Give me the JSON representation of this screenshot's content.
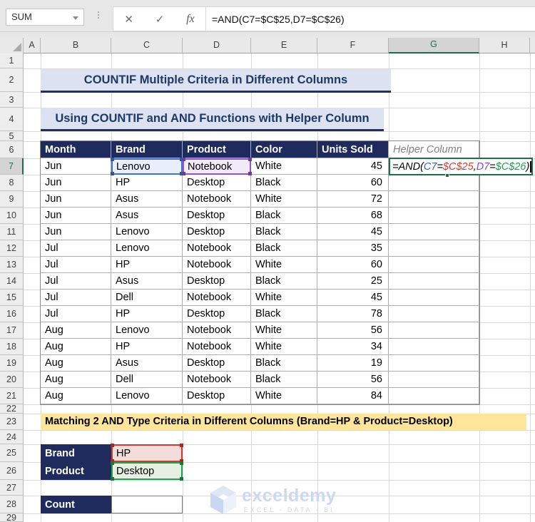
{
  "formula_bar": {
    "name_box": "SUM",
    "cancel_icon": "✕",
    "enter_icon": "✓",
    "fx_icon": "fx",
    "formula": "=AND(C7=$C$25,D7=$C$26)"
  },
  "grid": {
    "column_letters": [
      "A",
      "B",
      "C",
      "D",
      "E",
      "F",
      "G",
      "H"
    ],
    "active_column": "G",
    "active_row": 7,
    "row_count": 29
  },
  "titles": {
    "main": "COUNTIF Multiple Criteria in Different Columns",
    "sub": "Using COUNTIF and AND Functions with Helper Column"
  },
  "table": {
    "headers": [
      "Month",
      "Brand",
      "Product",
      "Color",
      "Units Sold",
      "Helper Column"
    ],
    "rows": [
      [
        "Jun",
        "Lenovo",
        "Notebook",
        "White",
        "45",
        ""
      ],
      [
        "Jun",
        "HP",
        "Desktop",
        "Black",
        "60",
        ""
      ],
      [
        "Jun",
        "Asus",
        "Notebook",
        "White",
        "72",
        ""
      ],
      [
        "Jun",
        "Asus",
        "Desktop",
        "Black",
        "68",
        ""
      ],
      [
        "Jun",
        "Lenovo",
        "Desktop",
        "Black",
        "45",
        ""
      ],
      [
        "Jul",
        "Lenovo",
        "Notebook",
        "Black",
        "35",
        ""
      ],
      [
        "Jul",
        "HP",
        "Notebook",
        "White",
        "60",
        ""
      ],
      [
        "Jul",
        "Asus",
        "Desktop",
        "Black",
        "25",
        ""
      ],
      [
        "Jul",
        "Dell",
        "Notebook",
        "White",
        "45",
        ""
      ],
      [
        "Jul",
        "HP",
        "Desktop",
        "Black",
        "78",
        ""
      ],
      [
        "Aug",
        "Lenovo",
        "Notebook",
        "White",
        "56",
        ""
      ],
      [
        "Aug",
        "HP",
        "Notebook",
        "White",
        "34",
        ""
      ],
      [
        "Aug",
        "Asus",
        "Desktop",
        "Black",
        "19",
        ""
      ],
      [
        "Aug",
        "Dell",
        "Notebook",
        "Black",
        "56",
        ""
      ],
      [
        "Aug",
        "Lenovo",
        "Desktop",
        "White",
        "84",
        ""
      ]
    ]
  },
  "cell_formula_tokens": [
    {
      "text": "=AND(",
      "color": "#000000"
    },
    {
      "text": "C7",
      "color": "#3a60c8"
    },
    {
      "text": "=",
      "color": "#000000"
    },
    {
      "text": "$C$25",
      "color": "#d43e36"
    },
    {
      "text": ",",
      "color": "#000000"
    },
    {
      "text": "D7",
      "color": "#8a4bc9"
    },
    {
      "text": "=",
      "color": "#000000"
    },
    {
      "text": "$C$26",
      "color": "#1d9e50"
    },
    {
      "text": ")",
      "color": "#000000"
    }
  ],
  "banner": "Matching 2 AND Type Criteria in Different Columns (Brand=HP & Product=Desktop)",
  "criteria": {
    "rows": [
      {
        "label": "Brand",
        "value": "HP"
      },
      {
        "label": "Product",
        "value": "Desktop"
      }
    ],
    "count_label": "Count",
    "count_value": ""
  },
  "watermark": {
    "brand": "exceldemy",
    "tagline": "EXCEL - DATA - BI"
  },
  "colors": {
    "header_fill": "#1f2b5c",
    "title_fill": "#dce2f1",
    "title_text": "#1f3864",
    "banner_fill": "#ffe599",
    "ref_blue": "#4472c4",
    "ref_red": "#d13a33",
    "ref_purple": "#9254c8",
    "ref_green": "#21a04d",
    "edit_border_green": "#1e7044"
  }
}
